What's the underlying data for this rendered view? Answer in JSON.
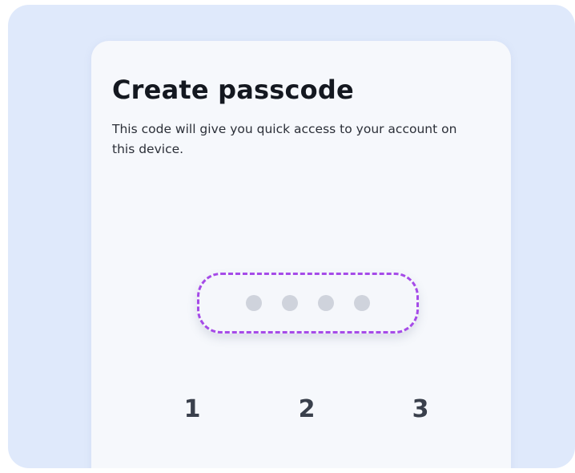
{
  "screen": {
    "title": "Create passcode",
    "subtitle": "This code will give you quick access to your account on this device."
  },
  "passcode": {
    "length": 4,
    "entered": 0,
    "dot_color": "#cfd3dc",
    "border_color": "#a64be8"
  },
  "keypad": {
    "keys": [
      "1",
      "2",
      "3"
    ]
  },
  "colors": {
    "background": "#dfe9fb",
    "card": "#f6f8fc",
    "title": "#141820"
  }
}
